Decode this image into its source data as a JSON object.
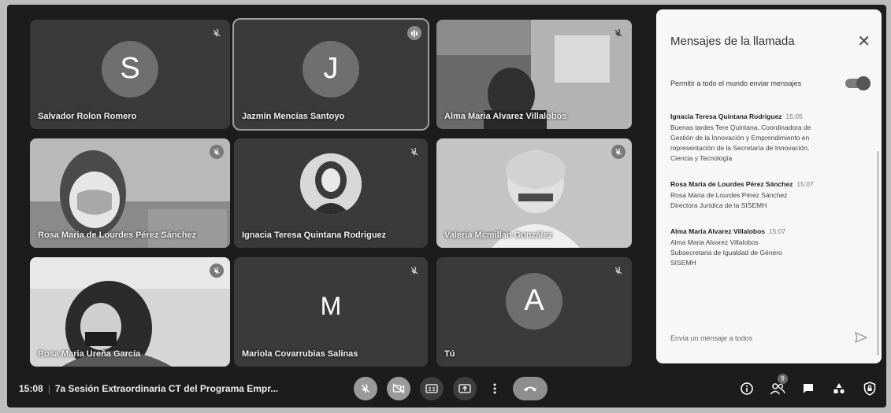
{
  "tiles": [
    {
      "name": "Salvador Rolon Romero",
      "letter": "S"
    },
    {
      "name": "Jazmín Mencías Santoyo",
      "letter": "J"
    },
    {
      "name": "Alma Maria Alvarez Villalobos"
    },
    {
      "name": "Rosa Maria de Lourdes Pérez Sánchez"
    },
    {
      "name": "Ignacia Teresa Quintana Rodriguez"
    },
    {
      "name": "Valeria Mcmillan González"
    },
    {
      "name": "Rosa Maria Ureña García"
    },
    {
      "name": "Mariola Covarrubias Salinas",
      "letter": "M"
    },
    {
      "name": "Tú",
      "letter": "A"
    }
  ],
  "panel": {
    "title": "Mensajes de la llamada",
    "close": "✕",
    "allow_label": "Permitir a todo el mundo enviar mensajes",
    "input_placeholder": "Envía un mensaje a todos",
    "messages": [
      {
        "sender": "Ignacia Teresa Quintana Rodriguez",
        "time": "15:05",
        "lines": [
          "Buenas tardes Tere Quintana, Coordinadora de",
          "Gestión de la Innovación y Emprendimiento en",
          "representación de la Secretaría de Innovación,",
          "Ciencia y Tecnología"
        ]
      },
      {
        "sender": "Rosa Maria de Lourdes Pérez Sánchez",
        "time": "15:07",
        "lines": [
          "Rosa Maria de Lourdes Pérez Sánchez",
          "Directora Jurídica de la SISEMH"
        ]
      },
      {
        "sender": "Alma Maria Alvarez Villalobos",
        "time": "15:07",
        "lines": [
          "Alma Maria Alvarez Villalobos",
          "Subsecretaria de Igualdad de Género",
          "SISEMH"
        ]
      }
    ]
  },
  "bar": {
    "time": "15:08",
    "separator": "|",
    "meeting_title": "7a Sesión Extraordinaria CT del Programa Empr...",
    "participant_count": "9"
  },
  "colors": {
    "background": "#1c1c1c",
    "panel": "#f7f7f7",
    "tile": "#3a3a3a"
  }
}
